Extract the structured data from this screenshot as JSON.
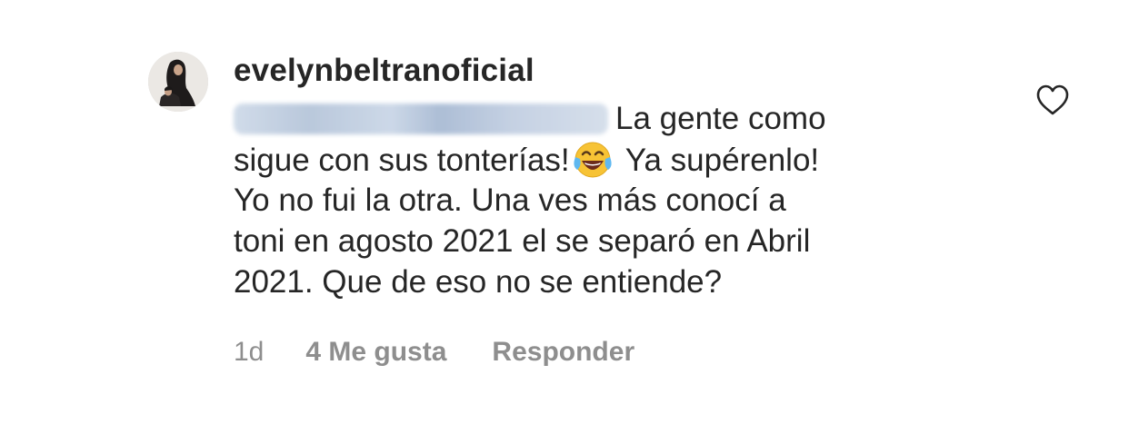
{
  "comment": {
    "username": "evelynbeltranoficial",
    "text_lines": {
      "line1": "La gente como",
      "line2a": "sigue con sus tonterías!",
      "line2b": " Ya supérenlo!",
      "line3": "Yo no fui la otra. Una ves más conocí a",
      "line4": "toni en agosto 2021 el se separó en Abril",
      "line5": "2021. Que de eso no se entiende?"
    },
    "emoji": "😂",
    "meta": {
      "time": "1d",
      "likes": "4 Me gusta",
      "reply": "Responder"
    }
  },
  "icons": {
    "like": "heart-outline-icon",
    "emoji": "face-with-tears-of-joy-icon",
    "mention": "blurred-mention"
  },
  "colors": {
    "text": "#262626",
    "secondary": "#8e8e8e"
  }
}
